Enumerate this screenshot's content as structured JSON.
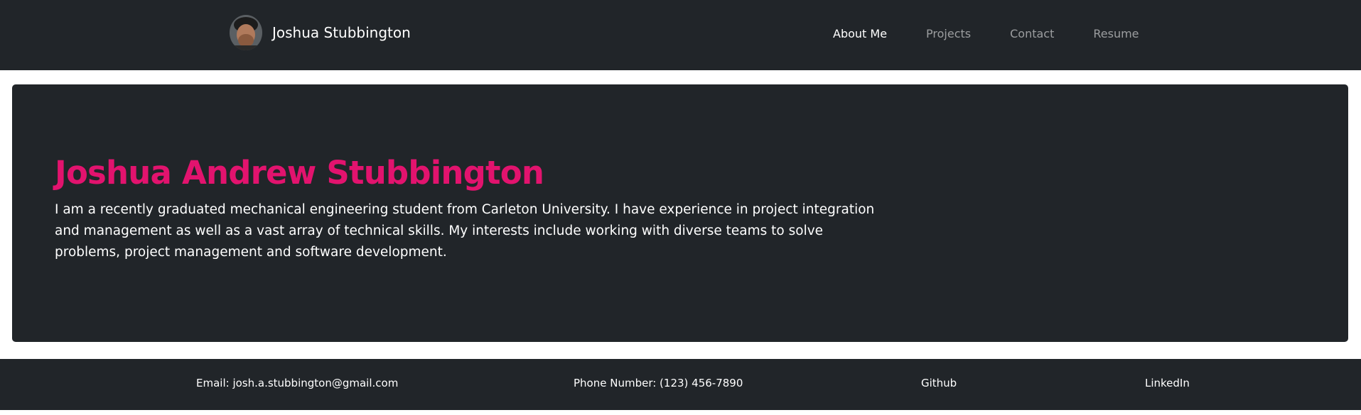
{
  "navbar": {
    "brand_name": "Joshua Stubbington",
    "links": [
      {
        "label": "About Me",
        "active": true
      },
      {
        "label": "Projects",
        "active": false
      },
      {
        "label": "Contact",
        "active": false
      },
      {
        "label": "Resume",
        "active": false
      }
    ]
  },
  "hero": {
    "title": "Joshua Andrew Stubbington",
    "description": "I am a recently graduated mechanical engineering student from Carleton University. I have experience in project integration and management as well as a vast array of technical skills. My interests include working with diverse teams to solve problems, project management and software development."
  },
  "footer": {
    "email": "Email: josh.a.stubbington@gmail.com",
    "phone": "Phone Number: (123) 456-7890",
    "github": "Github",
    "linkedin": "LinkedIn"
  },
  "colors": {
    "dark_background": "#212529",
    "accent": "#e2136e",
    "text": "#ffffff",
    "muted_nav": "rgba(255,255,255,0.55)"
  }
}
